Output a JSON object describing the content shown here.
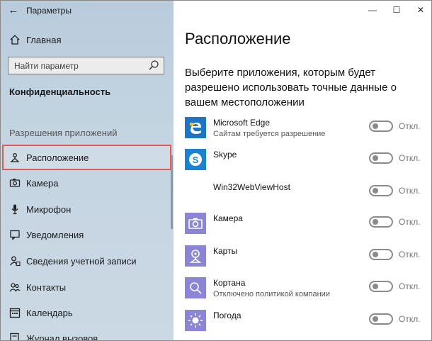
{
  "window": {
    "app_title": "Параметры",
    "controls": {
      "minimize": "—",
      "maximize": "☐",
      "close": "✕"
    }
  },
  "nav": {
    "home_label": "Главная",
    "search_placeholder": "Найти параметр",
    "section_title": "Конфиденциальность",
    "group_title": "Разрешения приложений",
    "items": [
      {
        "label": "Расположение",
        "icon": "location-icon",
        "selected": true
      },
      {
        "label": "Камера",
        "icon": "camera-icon"
      },
      {
        "label": "Микрофон",
        "icon": "microphone-icon"
      },
      {
        "label": "Уведомления",
        "icon": "notifications-icon"
      },
      {
        "label": "Сведения учетной записи",
        "icon": "account-info-icon"
      },
      {
        "label": "Контакты",
        "icon": "contacts-icon"
      },
      {
        "label": "Календарь",
        "icon": "calendar-icon"
      },
      {
        "label": "Журнал вызовов",
        "icon": "call-history-icon"
      }
    ]
  },
  "main": {
    "title": "Расположение",
    "description": "Выберите приложения, которым будет разрешено использовать точные данные о вашем местоположении",
    "apps": [
      {
        "name": "Microsoft Edge",
        "sub": "Сайтам требуется разрешение",
        "state": "Откл.",
        "icon": "edge-icon",
        "color": "#1e75c4"
      },
      {
        "name": "Skype",
        "sub": "",
        "state": "Откл.",
        "icon": "skype-icon",
        "color": "#1a82d1"
      },
      {
        "name": "Win32WebViewHost",
        "sub": "",
        "state": "Откл.",
        "icon": "none",
        "color": "#ffffff"
      },
      {
        "name": "Камера",
        "sub": "",
        "state": "Откл.",
        "icon": "camera-app-icon",
        "color": "#8a85d6"
      },
      {
        "name": "Карты",
        "sub": "",
        "state": "Откл.",
        "icon": "maps-icon",
        "color": "#8a85d6"
      },
      {
        "name": "Кортана",
        "sub": "Отключено политикой компании",
        "state": "Откл.",
        "icon": "cortana-icon",
        "color": "#8a85d6"
      },
      {
        "name": "Погода",
        "sub": "",
        "state": "Откл.",
        "icon": "weather-icon",
        "color": "#8a85d6"
      }
    ]
  },
  "colors": {
    "accent_highlight": "#e05a5a",
    "nav_background": "#c4d4e1",
    "toggle_off": "#8a8a8a"
  }
}
